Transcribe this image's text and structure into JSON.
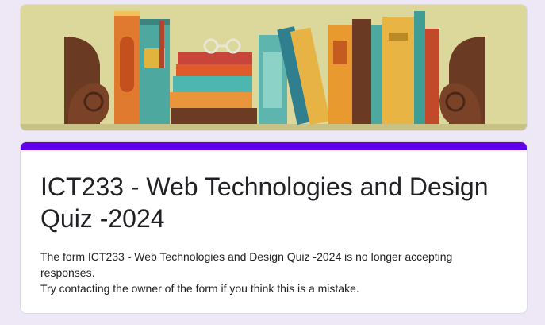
{
  "theme": {
    "background": "#ede7f6",
    "accent": "#6200ea",
    "card_background": "#ffffff"
  },
  "header_image": {
    "subject": "illustration of books on a shelf between bookends",
    "icon": "books-illustration"
  },
  "form": {
    "title": "ICT233 - Web Technologies and Design Quiz -2024",
    "closed_message": "The form ICT233 - Web Technologies and Design Quiz -2024 is no longer accepting responses.",
    "contact_message": "Try contacting the owner of the form if you think this is a mistake."
  }
}
